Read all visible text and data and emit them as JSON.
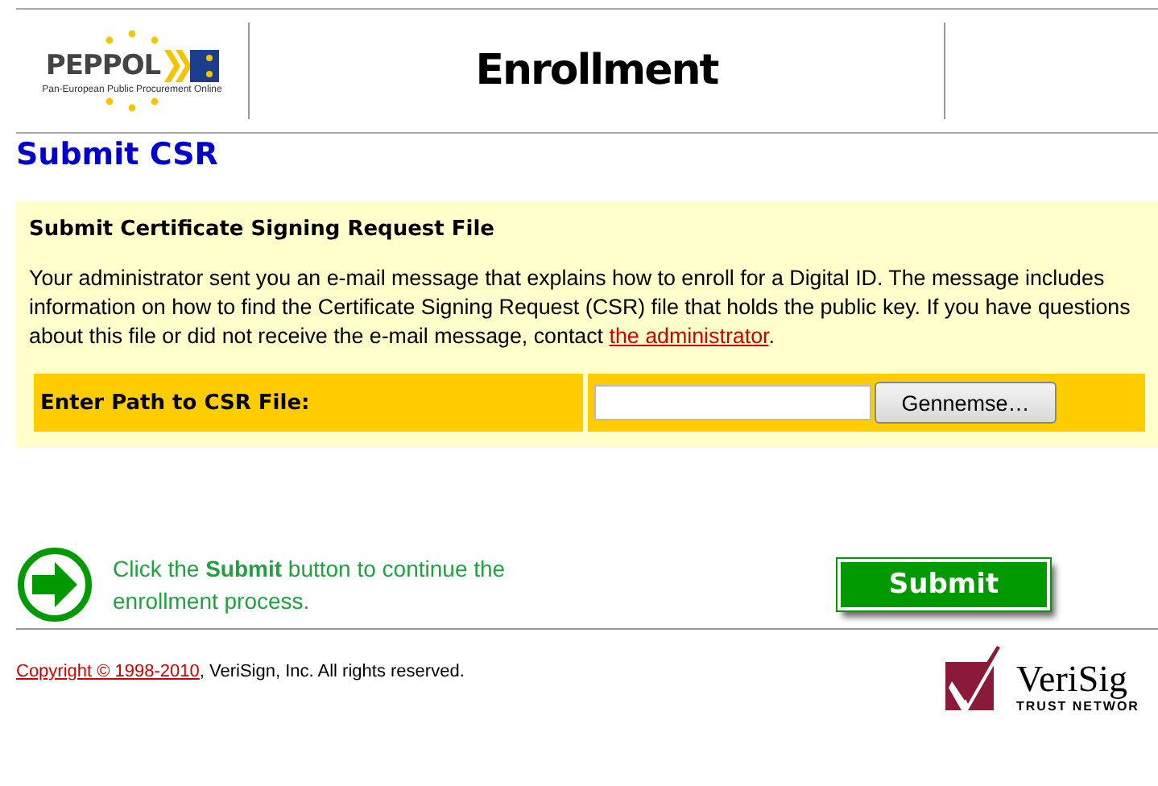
{
  "header": {
    "logo": {
      "name": "PEPPOL",
      "tagline": "Pan-European Public Procurement Online"
    },
    "title": "Enrollment"
  },
  "page_title": "Submit CSR",
  "panel": {
    "heading": "Submit Certificate Signing Request File",
    "text": "Your administrator sent you an e-mail message that explains how to enroll for a Digital ID. The message includes information on how to find the Certificate Signing Request (CSR) file that holds the public key. If you have questions about this file or did not receive the e-mail message, contact ",
    "link": "the administrator",
    "text_end": ".",
    "form": {
      "label": "Enter Path to CSR File:",
      "browse_button": "Gennemse…"
    }
  },
  "instruction": "Click the **Submit** button to continue the enrollment process.",
  "submit_button": "Submit",
  "footer": {
    "copyright_link": "Copyright © 1998-2010",
    "copyright_text": ", VeriSign, Inc. All rights reserved.",
    "logo": {
      "name": "VeriSig",
      "tagline": "TRUST NETWOR"
    }
  }
}
